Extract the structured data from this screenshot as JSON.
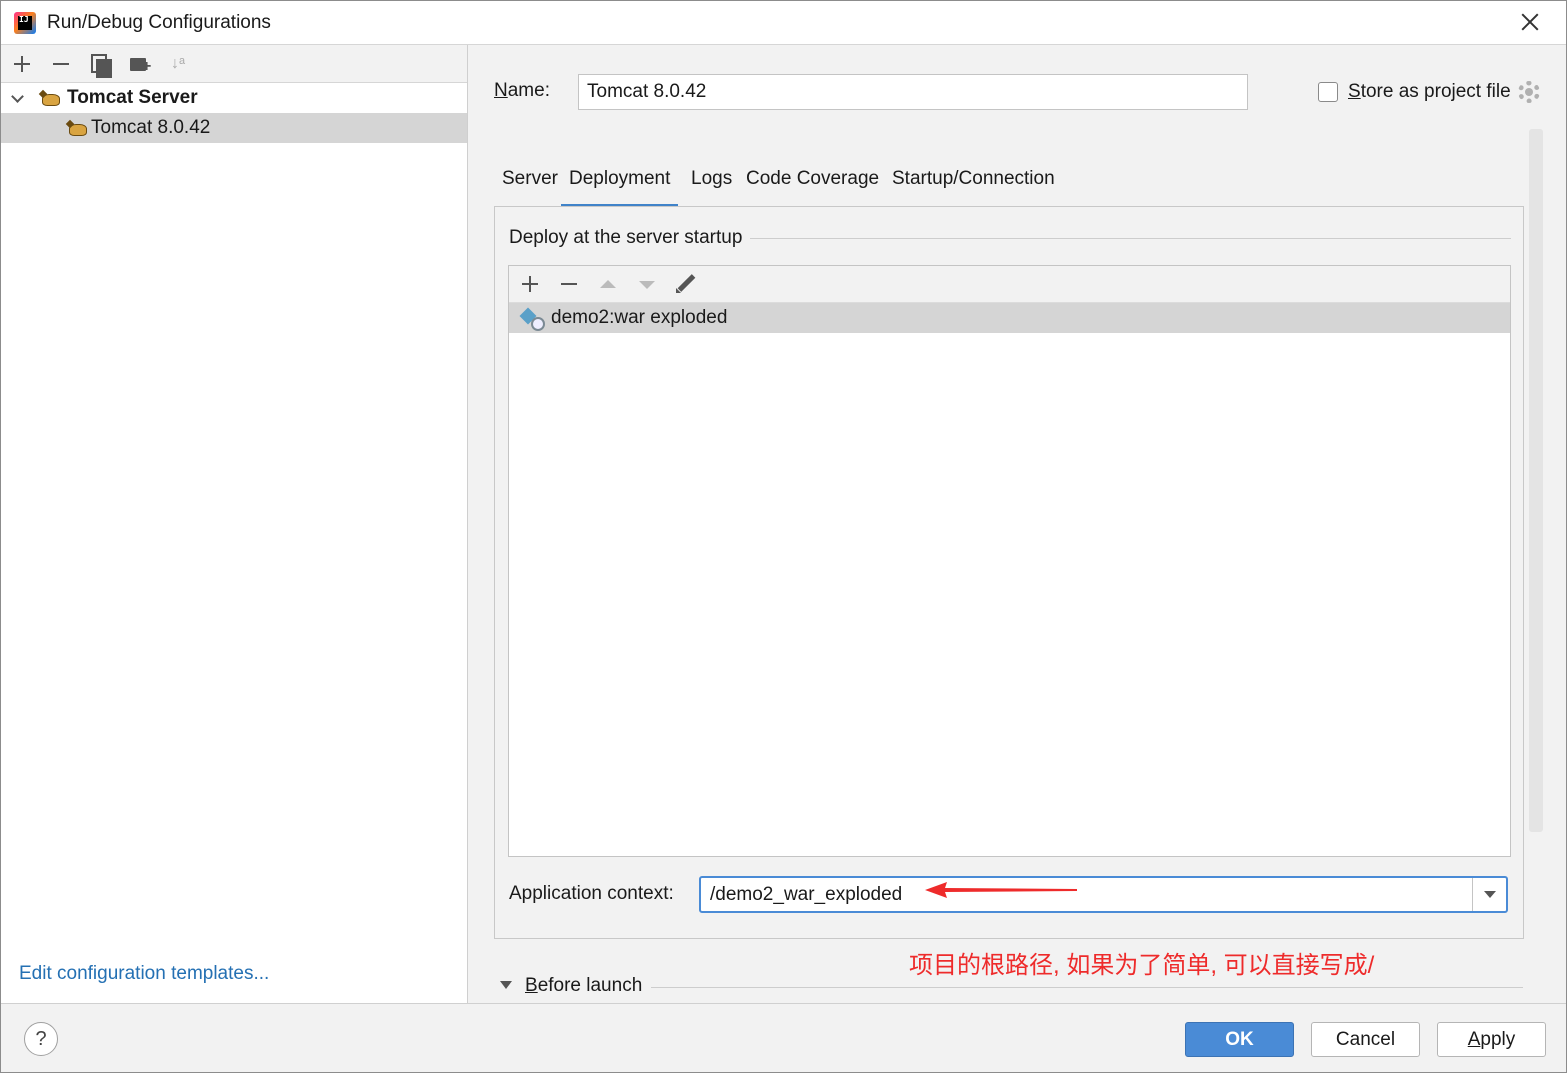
{
  "window": {
    "title": "Run/Debug Configurations"
  },
  "left": {
    "toolbar": {
      "add_icon": "plus-icon",
      "remove_icon": "minus-icon",
      "copy_icon": "copy-icon",
      "folder_icon": "new-folder-icon",
      "sort_icon": "sort-icon",
      "sort_glyph": "↓ᵃ"
    },
    "tree": {
      "group_label": "Tomcat Server",
      "item_label": "Tomcat 8.0.42"
    },
    "edit_templates": "Edit configuration templates..."
  },
  "form": {
    "name_label_first": "N",
    "name_label_rest": "ame:",
    "name_value": "Tomcat 8.0.42",
    "store_label_first": "S",
    "store_label_rest": "tore as project file",
    "store_checked": false
  },
  "tabs": [
    "Server",
    "Deployment",
    "Logs",
    "Code Coverage",
    "Startup/Connection"
  ],
  "active_tab": "Deployment",
  "deployment": {
    "section_title": "Deploy at the server startup",
    "artifacts": [
      "demo2:war exploded"
    ],
    "context_label": "Application context:",
    "context_value": "/demo2_war_exploded"
  },
  "annotation": {
    "text": "项目的根路径, 如果为了简单, 可以直接写成/",
    "color": "#ee2b2b"
  },
  "before_launch": {
    "first": "B",
    "rest": "efore launch"
  },
  "buttons": {
    "help": "?",
    "ok": "OK",
    "cancel": "Cancel",
    "apply_first": "A",
    "apply_rest": "pply"
  },
  "colors": {
    "accent": "#4a8bd6",
    "link": "#2470b3",
    "selection": "#d5d5d5"
  }
}
